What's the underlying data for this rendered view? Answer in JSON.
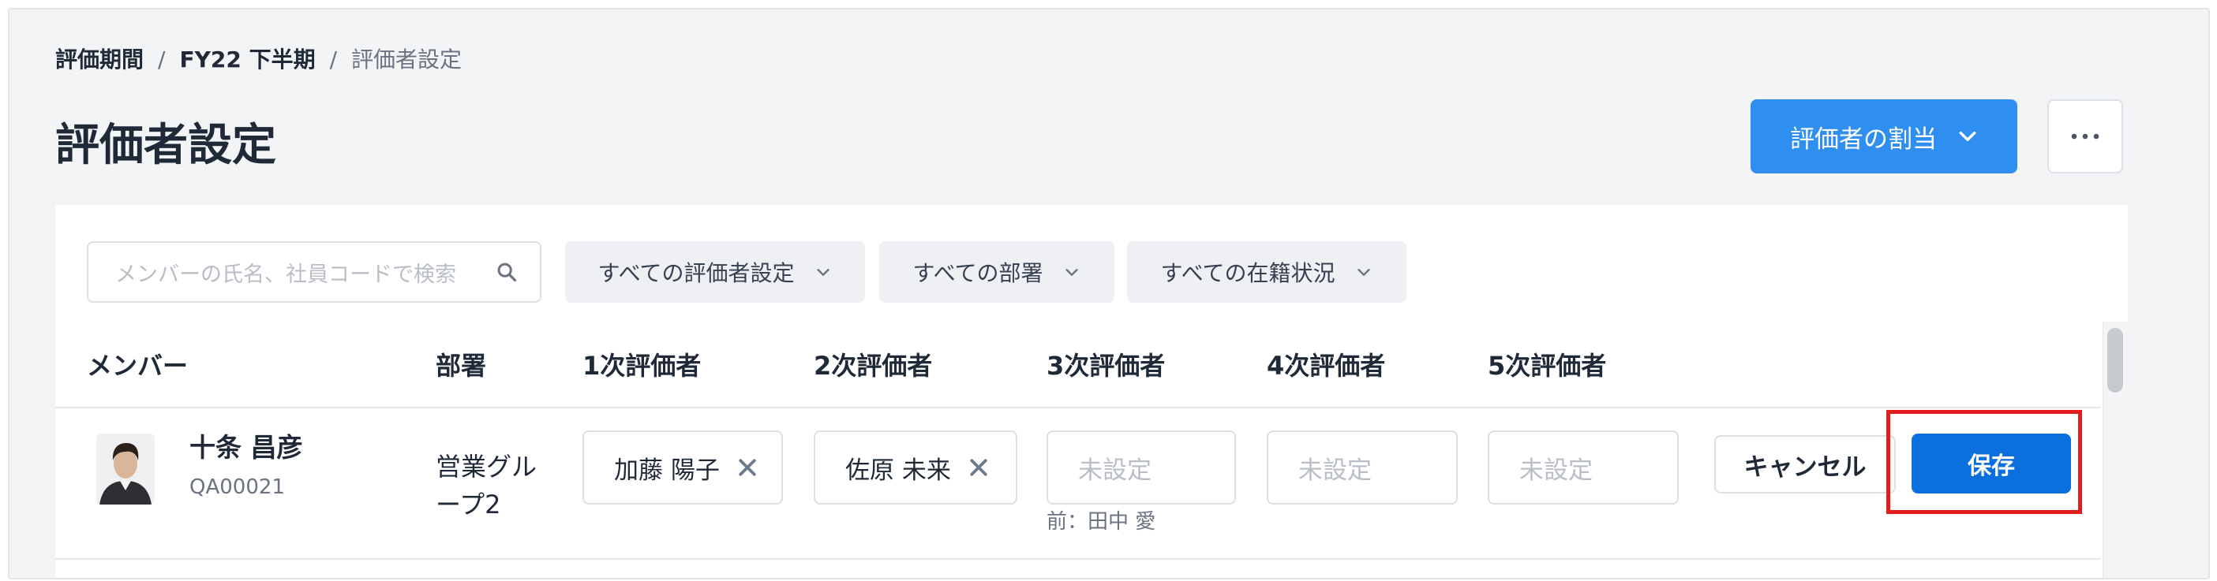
{
  "breadcrumb": {
    "items": [
      "評価期間",
      "FY22 下半期"
    ],
    "current": "評価者設定",
    "separator": "/"
  },
  "page": {
    "title": "評価者設定"
  },
  "actions": {
    "assign_label": "評価者の割当",
    "more_label": "…"
  },
  "filters": {
    "search_placeholder": "メンバーの氏名、社員コードで検索",
    "evaluator_setting": "すべての評価者設定",
    "department": "すべての部署",
    "status": "すべての在籍状況"
  },
  "table": {
    "headers": [
      "メンバー",
      "部署",
      "1次評価者",
      "2次評価者",
      "3次評価者",
      "4次評価者",
      "5次評価者"
    ],
    "rows": [
      {
        "name": "十条 昌彦",
        "code": "QA00021",
        "department": "営業グループ2",
        "evaluator1": "加藤 陽子",
        "evaluator2": "佐原 未来",
        "evaluator3": "未設定",
        "evaluator3_previous": "前：田中 愛",
        "evaluator4": "未設定",
        "evaluator5": "未設定",
        "cancel_label": "キャンセル",
        "save_label": "保存"
      }
    ]
  },
  "colors": {
    "primary": "#2f8ff0",
    "save": "#0b6fde",
    "highlight": "#e11d1d"
  }
}
